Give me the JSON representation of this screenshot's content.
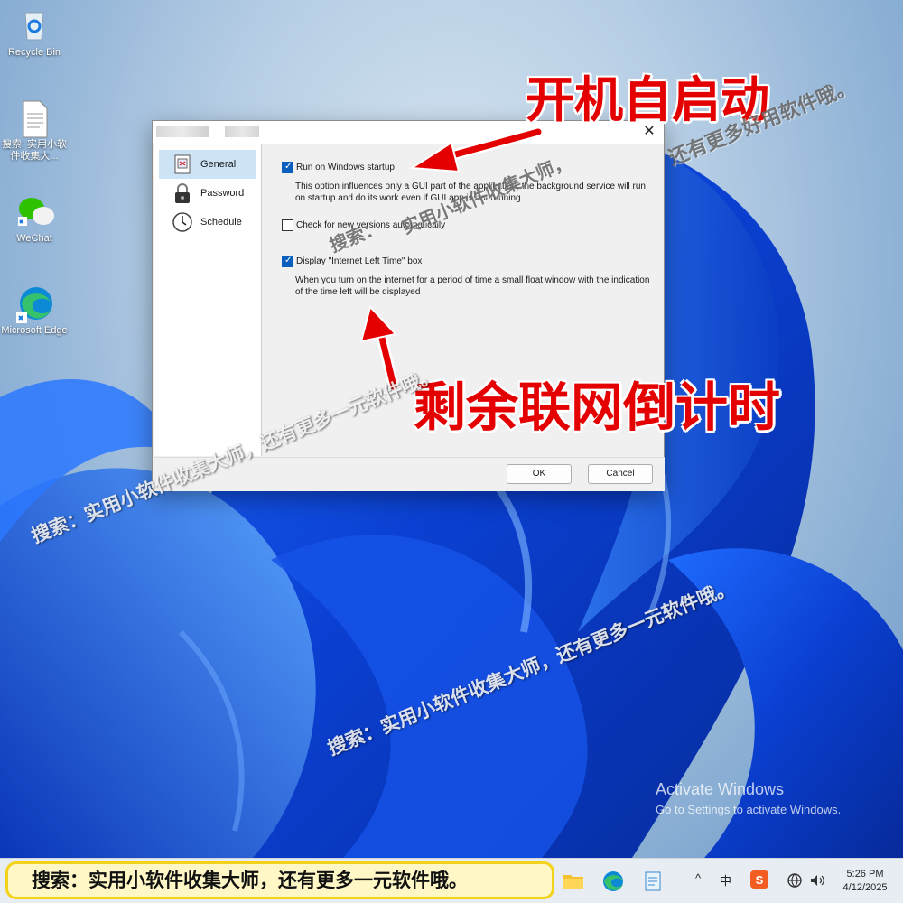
{
  "desktop": {
    "icons": [
      {
        "label": "Recycle Bin"
      },
      {
        "label": "搜索: 实用小软件收集大..."
      },
      {
        "label": "WeChat"
      },
      {
        "label": "Microsoft Edge"
      }
    ]
  },
  "dialog": {
    "close_glyph": "✕",
    "sidebar": [
      {
        "label": "General",
        "icon": "document-icon",
        "active": true
      },
      {
        "label": "Password",
        "icon": "padlock-icon",
        "active": false
      },
      {
        "label": "Schedule",
        "icon": "clock-icon",
        "active": false
      }
    ],
    "options": [
      {
        "label": "Run on Windows startup",
        "checked": true,
        "description": "This option influences only a GUI part of the application, the background service will run on startup and do its work even if GUI app is not running"
      },
      {
        "label": "Check for new versions automatically",
        "checked": false,
        "description": ""
      },
      {
        "label": "Display \"Internet Left Time\" box",
        "checked": true,
        "description": "When you turn on the internet for a period of time a small float window with the indication of the time left will be displayed"
      }
    ],
    "ok_label": "OK",
    "cancel_label": "Cancel"
  },
  "annotations": {
    "startup": "开机自启动",
    "countdown": "剩余联网倒计时"
  },
  "watermarks": [
    "还有更多好用软件哦。",
    "实用小软件收集大师，",
    "搜索：实用小软件收集大师，还有更多一元软件哦。",
    "搜索：实用小软件收集大师，还有更多一元软件哦。",
    "搜索：实用小软件收集大师，还有更多一元软件哦。"
  ],
  "activate": {
    "title": "Activate Windows",
    "subtitle": "Go to Settings to activate Windows."
  },
  "taskbar": {
    "promo": "搜索：实用小软件收集大师，还有更多一元软件哦。",
    "tray_chevron": "^",
    "ime": "中",
    "time": "5:26 PM",
    "date": "4/12/2025"
  }
}
